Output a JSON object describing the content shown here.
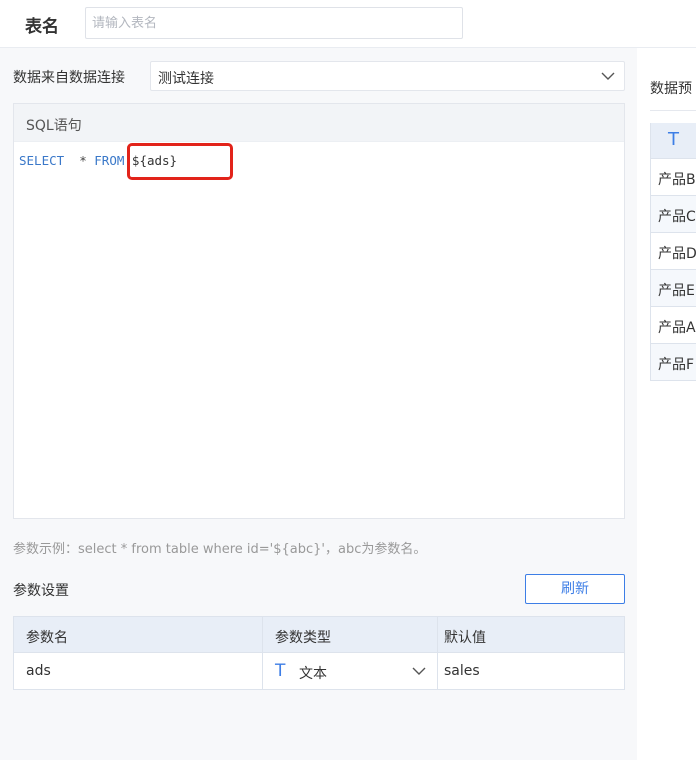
{
  "header": {
    "title": "表名",
    "name_placeholder": "请输入表名"
  },
  "source": {
    "label": "数据来自数据连接",
    "selected": "测试连接"
  },
  "sql": {
    "header": "SQL语句",
    "keyword_select": "SELECT",
    "operator": "*",
    "keyword_from": "FROM",
    "param_ref": "${ads}"
  },
  "example_text": "参数示例：select * from table where id='${abc}'，abc为参数名。",
  "params": {
    "label": "参数设置",
    "refresh_label": "刷新",
    "columns": [
      "参数名",
      "参数类型",
      "默认值"
    ],
    "rows": [
      {
        "name": "ads",
        "type_icon": "T",
        "type": "文本",
        "default": "sales"
      }
    ]
  },
  "preview": {
    "label": "数据预",
    "column_icon": "T",
    "rows": [
      "产品B",
      "产品C",
      "产品D",
      "产品E",
      "产品A",
      "产品F"
    ]
  },
  "colors": {
    "accent": "#3d7ee6",
    "highlight": "#e2231a",
    "keyword": "#3a78c9"
  }
}
